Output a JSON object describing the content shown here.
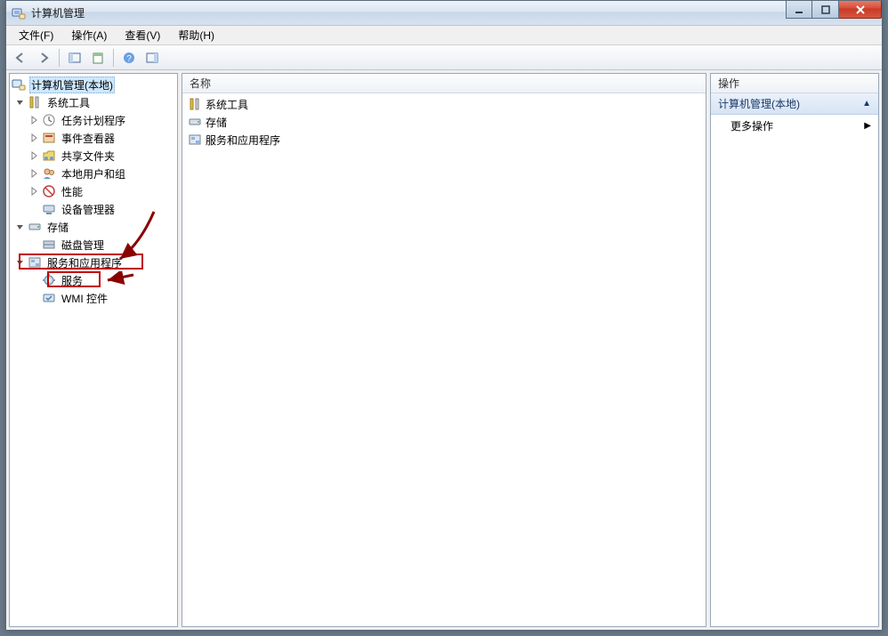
{
  "window": {
    "title": "计算机管理"
  },
  "menu": {
    "file": "文件(F)",
    "action": "操作(A)",
    "view": "查看(V)",
    "help": "帮助(H)"
  },
  "tree": {
    "root": "计算机管理(本地)",
    "system_tools": "系统工具",
    "task_scheduler": "任务计划程序",
    "event_viewer": "事件查看器",
    "shared_folders": "共享文件夹",
    "local_users": "本地用户和组",
    "performance": "性能",
    "device_manager": "设备管理器",
    "storage": "存储",
    "disk_management": "磁盘管理",
    "services_and_apps": "服务和应用程序",
    "services": "服务",
    "wmi_control": "WMI 控件"
  },
  "list": {
    "column_name": "名称",
    "rows": {
      "system_tools": "系统工具",
      "storage": "存储",
      "services_and_apps": "服务和应用程序"
    }
  },
  "actions": {
    "header": "操作",
    "section_title": "计算机管理(本地)",
    "more_actions": "更多操作"
  }
}
